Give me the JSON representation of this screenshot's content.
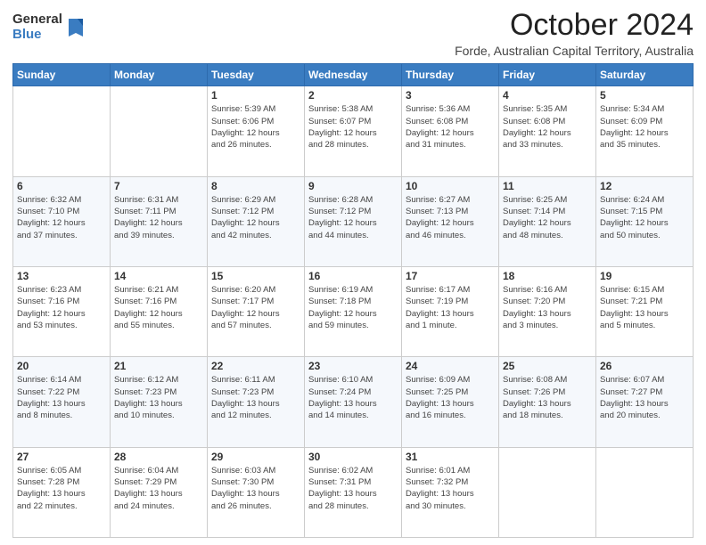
{
  "logo": {
    "general": "General",
    "blue": "Blue"
  },
  "header": {
    "month": "October 2024",
    "subtitle": "Forde, Australian Capital Territory, Australia"
  },
  "days_of_week": [
    "Sunday",
    "Monday",
    "Tuesday",
    "Wednesday",
    "Thursday",
    "Friday",
    "Saturday"
  ],
  "weeks": [
    [
      {
        "day": "",
        "info": ""
      },
      {
        "day": "",
        "info": ""
      },
      {
        "day": "1",
        "info": "Sunrise: 5:39 AM\nSunset: 6:06 PM\nDaylight: 12 hours\nand 26 minutes."
      },
      {
        "day": "2",
        "info": "Sunrise: 5:38 AM\nSunset: 6:07 PM\nDaylight: 12 hours\nand 28 minutes."
      },
      {
        "day": "3",
        "info": "Sunrise: 5:36 AM\nSunset: 6:08 PM\nDaylight: 12 hours\nand 31 minutes."
      },
      {
        "day": "4",
        "info": "Sunrise: 5:35 AM\nSunset: 6:08 PM\nDaylight: 12 hours\nand 33 minutes."
      },
      {
        "day": "5",
        "info": "Sunrise: 5:34 AM\nSunset: 6:09 PM\nDaylight: 12 hours\nand 35 minutes."
      }
    ],
    [
      {
        "day": "6",
        "info": "Sunrise: 6:32 AM\nSunset: 7:10 PM\nDaylight: 12 hours\nand 37 minutes."
      },
      {
        "day": "7",
        "info": "Sunrise: 6:31 AM\nSunset: 7:11 PM\nDaylight: 12 hours\nand 39 minutes."
      },
      {
        "day": "8",
        "info": "Sunrise: 6:29 AM\nSunset: 7:12 PM\nDaylight: 12 hours\nand 42 minutes."
      },
      {
        "day": "9",
        "info": "Sunrise: 6:28 AM\nSunset: 7:12 PM\nDaylight: 12 hours\nand 44 minutes."
      },
      {
        "day": "10",
        "info": "Sunrise: 6:27 AM\nSunset: 7:13 PM\nDaylight: 12 hours\nand 46 minutes."
      },
      {
        "day": "11",
        "info": "Sunrise: 6:25 AM\nSunset: 7:14 PM\nDaylight: 12 hours\nand 48 minutes."
      },
      {
        "day": "12",
        "info": "Sunrise: 6:24 AM\nSunset: 7:15 PM\nDaylight: 12 hours\nand 50 minutes."
      }
    ],
    [
      {
        "day": "13",
        "info": "Sunrise: 6:23 AM\nSunset: 7:16 PM\nDaylight: 12 hours\nand 53 minutes."
      },
      {
        "day": "14",
        "info": "Sunrise: 6:21 AM\nSunset: 7:16 PM\nDaylight: 12 hours\nand 55 minutes."
      },
      {
        "day": "15",
        "info": "Sunrise: 6:20 AM\nSunset: 7:17 PM\nDaylight: 12 hours\nand 57 minutes."
      },
      {
        "day": "16",
        "info": "Sunrise: 6:19 AM\nSunset: 7:18 PM\nDaylight: 12 hours\nand 59 minutes."
      },
      {
        "day": "17",
        "info": "Sunrise: 6:17 AM\nSunset: 7:19 PM\nDaylight: 13 hours\nand 1 minute."
      },
      {
        "day": "18",
        "info": "Sunrise: 6:16 AM\nSunset: 7:20 PM\nDaylight: 13 hours\nand 3 minutes."
      },
      {
        "day": "19",
        "info": "Sunrise: 6:15 AM\nSunset: 7:21 PM\nDaylight: 13 hours\nand 5 minutes."
      }
    ],
    [
      {
        "day": "20",
        "info": "Sunrise: 6:14 AM\nSunset: 7:22 PM\nDaylight: 13 hours\nand 8 minutes."
      },
      {
        "day": "21",
        "info": "Sunrise: 6:12 AM\nSunset: 7:23 PM\nDaylight: 13 hours\nand 10 minutes."
      },
      {
        "day": "22",
        "info": "Sunrise: 6:11 AM\nSunset: 7:23 PM\nDaylight: 13 hours\nand 12 minutes."
      },
      {
        "day": "23",
        "info": "Sunrise: 6:10 AM\nSunset: 7:24 PM\nDaylight: 13 hours\nand 14 minutes."
      },
      {
        "day": "24",
        "info": "Sunrise: 6:09 AM\nSunset: 7:25 PM\nDaylight: 13 hours\nand 16 minutes."
      },
      {
        "day": "25",
        "info": "Sunrise: 6:08 AM\nSunset: 7:26 PM\nDaylight: 13 hours\nand 18 minutes."
      },
      {
        "day": "26",
        "info": "Sunrise: 6:07 AM\nSunset: 7:27 PM\nDaylight: 13 hours\nand 20 minutes."
      }
    ],
    [
      {
        "day": "27",
        "info": "Sunrise: 6:05 AM\nSunset: 7:28 PM\nDaylight: 13 hours\nand 22 minutes."
      },
      {
        "day": "28",
        "info": "Sunrise: 6:04 AM\nSunset: 7:29 PM\nDaylight: 13 hours\nand 24 minutes."
      },
      {
        "day": "29",
        "info": "Sunrise: 6:03 AM\nSunset: 7:30 PM\nDaylight: 13 hours\nand 26 minutes."
      },
      {
        "day": "30",
        "info": "Sunrise: 6:02 AM\nSunset: 7:31 PM\nDaylight: 13 hours\nand 28 minutes."
      },
      {
        "day": "31",
        "info": "Sunrise: 6:01 AM\nSunset: 7:32 PM\nDaylight: 13 hours\nand 30 minutes."
      },
      {
        "day": "",
        "info": ""
      },
      {
        "day": "",
        "info": ""
      }
    ]
  ],
  "accent_color": "#3a7cc1"
}
